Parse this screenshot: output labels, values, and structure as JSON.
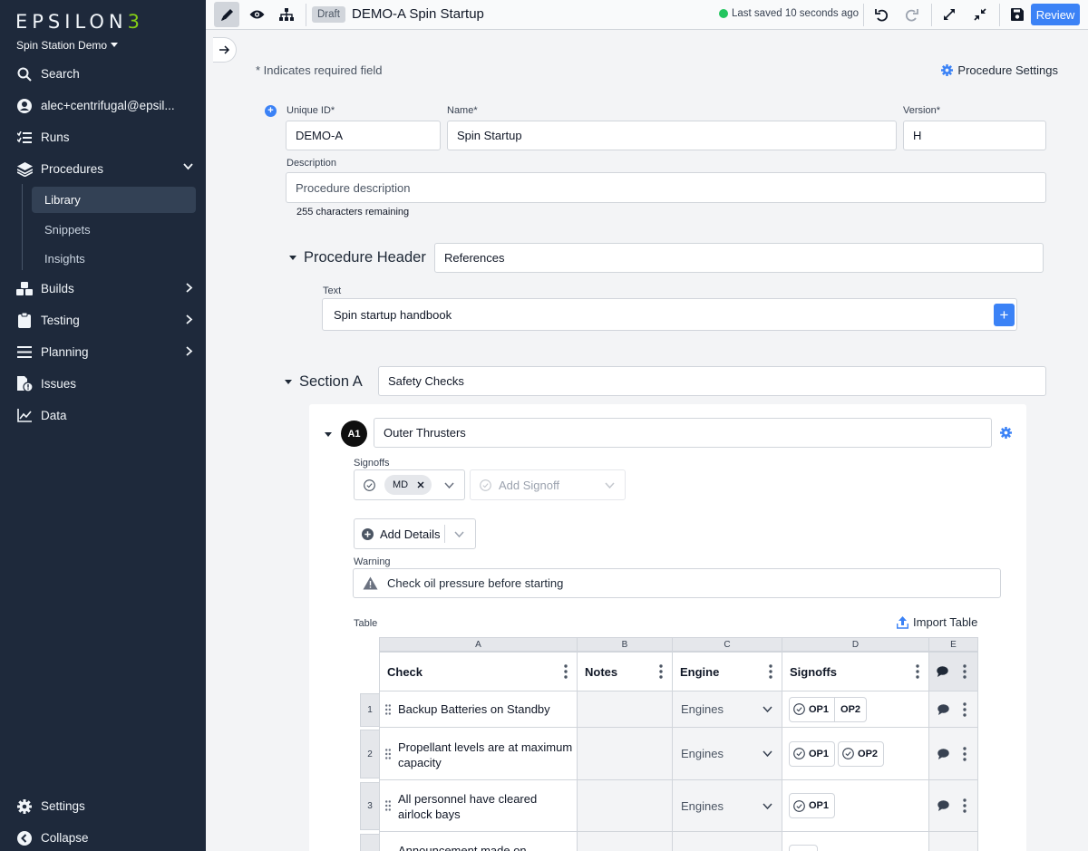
{
  "sidebar": {
    "logo_main": "EPSILON",
    "logo_accent": "3",
    "workspace": "Spin Station Demo",
    "items": [
      {
        "label": "Search"
      },
      {
        "label": "alec+centrifugal@epsil..."
      },
      {
        "label": "Runs"
      },
      {
        "label": "Procedures"
      },
      {
        "label": "Builds"
      },
      {
        "label": "Testing"
      },
      {
        "label": "Planning"
      },
      {
        "label": "Issues"
      },
      {
        "label": "Data"
      }
    ],
    "procedures_sub": [
      {
        "label": "Library"
      },
      {
        "label": "Snippets"
      },
      {
        "label": "Insights"
      }
    ],
    "bottom": [
      {
        "label": "Settings"
      },
      {
        "label": "Collapse"
      }
    ]
  },
  "toolbar": {
    "status_badge": "Draft",
    "title": "DEMO-A Spin Startup",
    "saved_text": "Last saved 10 seconds ago",
    "review_label": "Review"
  },
  "form": {
    "required_note": "* Indicates required field",
    "settings_label": "Procedure Settings",
    "unique_id_label": "Unique ID*",
    "unique_id_value": "DEMO-A",
    "name_label": "Name*",
    "name_value": "Spin Startup",
    "version_label": "Version*",
    "version_value": "H",
    "description_label": "Description",
    "description_placeholder": "Procedure description",
    "chars_remaining": "255 characters remaining"
  },
  "header_block": {
    "title": "Procedure Header",
    "name_value": "References",
    "text_label": "Text",
    "text_value": "Spin startup handbook"
  },
  "section": {
    "title": "Section A",
    "name_value": "Safety Checks",
    "step": {
      "badge": "A1",
      "name_value": "Outer Thrusters",
      "signoffs_label": "Signoffs",
      "signoff_chip": "MD",
      "add_signoff_placeholder": "Add Signoff",
      "add_details_label": "Add Details",
      "warning_label": "Warning",
      "warning_text": "Check oil pressure before starting",
      "table_label": "Table",
      "import_label": "Import Table"
    }
  },
  "table": {
    "column_letters": [
      "A",
      "B",
      "C",
      "D",
      "E"
    ],
    "headers": [
      "Check",
      "Notes",
      "Engine",
      "Signoffs"
    ],
    "rows": [
      {
        "num": "1",
        "check": "Backup Batteries on Standby",
        "engine": "Engines",
        "signoffs": [
          "OP1",
          "OP2"
        ],
        "grouped": true
      },
      {
        "num": "2",
        "check": "Propellant levels are at maximum capacity",
        "engine": "Engines",
        "signoffs": [
          "OP1",
          "OP2"
        ],
        "grouped": false
      },
      {
        "num": "3",
        "check": "All personnel have cleared airlock bays",
        "engine": "Engines",
        "signoffs": [
          "OP1"
        ],
        "grouped": false
      },
      {
        "num": "",
        "check": "Announcement made on",
        "engine": "",
        "signoffs": [],
        "grouped": false
      }
    ]
  },
  "colors": {
    "sidebar_bg": "#1e293b",
    "accent": "#3b82f6",
    "logo_accent": "#84cc16",
    "saved_dot": "#22c55e"
  }
}
